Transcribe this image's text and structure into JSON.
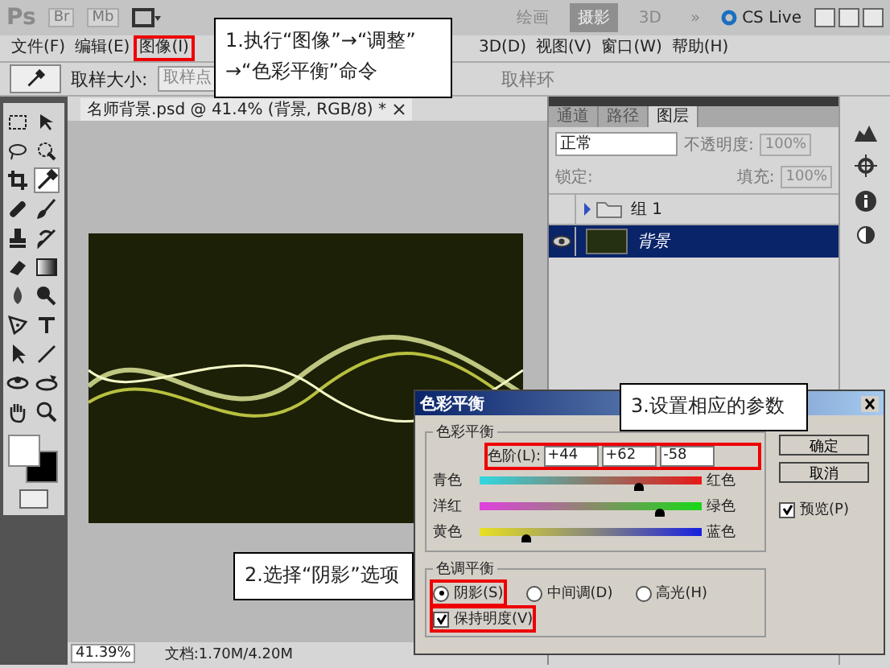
{
  "app_bar": {
    "logo": "Ps",
    "bridge": "Br",
    "mini_bridge": "Mb",
    "workspaces": [
      {
        "label": "绘画",
        "selected": false
      },
      {
        "label": "摄影",
        "selected": true
      },
      {
        "label": "3D",
        "selected": false
      }
    ],
    "more": "»",
    "cs_live": "CS Live"
  },
  "menu_left": [
    {
      "label": "文件(F)",
      "highlighted": false
    },
    {
      "label": "编辑(E)",
      "highlighted": false
    },
    {
      "label": "图像(I)",
      "highlighted": true
    }
  ],
  "menu_right": [
    {
      "label": "3D(D)",
      "highlighted": false
    },
    {
      "label": "视图(V)",
      "highlighted": false
    },
    {
      "label": "窗口(W)",
      "highlighted": false
    },
    {
      "label": "帮助(H)",
      "highlighted": false
    }
  ],
  "options_bar": {
    "sample_size_label": "取样大小:",
    "sample_size_value": "取样点",
    "sample_ring": "取样环"
  },
  "toolbox": {
    "tools": [
      {
        "kind": "marquee",
        "selected": false
      },
      {
        "kind": "move",
        "selected": false
      },
      {
        "kind": "lasso",
        "selected": false
      },
      {
        "kind": "quick-select",
        "selected": false
      },
      {
        "kind": "crop",
        "selected": false
      },
      {
        "kind": "eyedropper",
        "selected": true
      },
      {
        "kind": "bandage",
        "selected": false
      },
      {
        "kind": "brush",
        "selected": false
      },
      {
        "kind": "stamp",
        "selected": false
      },
      {
        "kind": "history-brush",
        "selected": false
      },
      {
        "kind": "eraser",
        "selected": false
      },
      {
        "kind": "gradient",
        "selected": false
      },
      {
        "kind": "drop",
        "selected": false
      },
      {
        "kind": "dodge",
        "selected": false
      },
      {
        "kind": "pen",
        "selected": false
      },
      {
        "kind": "type",
        "selected": false
      },
      {
        "kind": "arrow",
        "selected": false
      },
      {
        "kind": "line",
        "selected": false
      },
      {
        "kind": "rotate",
        "selected": false
      },
      {
        "kind": "orbit",
        "selected": false
      },
      {
        "kind": "hand",
        "selected": false
      },
      {
        "kind": "zoom",
        "selected": false
      }
    ]
  },
  "document": {
    "tab_title": "名师背景.psd @ 41.4% (背景, RGB/8) *",
    "zoom": "41.39%",
    "doc_info": "文档:1.70M/4.20M"
  },
  "layers_panel": {
    "tabs": [
      {
        "label": "通道",
        "selected": false
      },
      {
        "label": "路径",
        "selected": false
      },
      {
        "label": "图层",
        "selected": true
      }
    ],
    "blend_mode": "正常",
    "opacity_label": "不透明度:",
    "opacity": "100%",
    "lock_label": "锁定:",
    "fill_label": "填充:",
    "fill": "100%",
    "layers": [
      {
        "name": "组 1",
        "kind": "group",
        "visible": false,
        "selected": false
      },
      {
        "name": "背景",
        "kind": "image",
        "visible": true,
        "selected": true
      }
    ]
  },
  "dialog": {
    "title": "色彩平衡",
    "balance_group": "色彩平衡",
    "levels_label": "色阶(L):",
    "levels": [
      "+44",
      "+62",
      "-58"
    ],
    "levels_highlighted": true,
    "sliders": [
      {
        "left": "青色",
        "right": "红色",
        "level": 0.72
      },
      {
        "left": "洋红",
        "right": "绿色",
        "level": 0.81
      },
      {
        "left": "黄色",
        "right": "蓝色",
        "level": 0.21
      }
    ],
    "buttons": [
      "确定",
      "取消"
    ],
    "preview": {
      "label": "预览(P)",
      "checked": true
    },
    "tone_group": "色调平衡",
    "tones": [
      {
        "label": "阴影(S)",
        "selected": true,
        "highlighted": true
      },
      {
        "label": "中间调(D)",
        "selected": false,
        "highlighted": false
      },
      {
        "label": "高光(H)",
        "selected": false,
        "highlighted": false
      }
    ],
    "preserve": {
      "label": "保持明度(V)",
      "checked": true,
      "highlighted": true
    }
  },
  "callouts": [
    {
      "text": "1.执行“图像”→“调整”\n→“色彩平衡”命令"
    },
    {
      "text": "2.选择“阴影”选项"
    },
    {
      "text": "3.设置相应的参数"
    }
  ]
}
